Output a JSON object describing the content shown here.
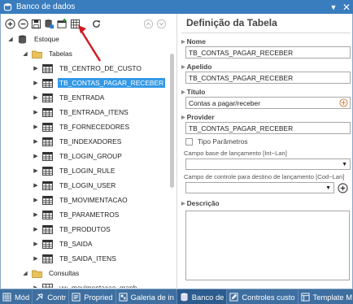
{
  "window": {
    "title": "Banco de dados",
    "pin_glyph": "▼",
    "close_glyph": "✕"
  },
  "toolbar": {
    "buttons": [
      "add-icon",
      "remove-icon",
      "save-icon",
      "database-save-icon",
      "table-new-icon",
      "grid-icon",
      "refresh-icon"
    ],
    "nav": [
      "up-icon",
      "down-icon"
    ]
  },
  "tree": {
    "root": {
      "label": "Estoque",
      "expander": "◢"
    },
    "tables_folder": {
      "label": "Tabelas",
      "expander": "◢"
    },
    "tables": [
      "TB_CENTRO_DE_CUSTO",
      "TB_CONTAS_PAGAR_RECEBER",
      "TB_ENTRADA",
      "TB_ENTRADA_ITENS",
      "TB_FORNECEDORES",
      "TB_INDEXADORES",
      "TB_LOGIN_GROUP",
      "TB_LOGIN_RULE",
      "TB_LOGIN_USER",
      "TB_MOVIMENTACAO",
      "TB_PARAMETROS",
      "TB_PRODUTOS",
      "TB_SAIDA",
      "TB_SAIDA_ITENS"
    ],
    "selected_table": "TB_CONTAS_PAGAR_RECEBER",
    "queries_folder": {
      "label": "Consultas",
      "expander": "◢"
    },
    "queries": [
      "vw_movimentacao_graph"
    ],
    "collapsed_glyph": "▶"
  },
  "definition": {
    "title": "Definição da Tabela",
    "nome_label": "Nome",
    "nome_value": "TB_CONTAS_PAGAR_RECEBER",
    "apelido_label": "Apelido",
    "apelido_value": "TB_CONTAS_PAGAR_RECEBER",
    "titulo_label": "Título",
    "titulo_value": "Contas a pagar/receber",
    "provider_label": "Provider",
    "provider_value": "TB_CONTAS_PAGAR_RECEBER",
    "tipo_parametros_label": "Tipo Parâmetros",
    "campo_base_label": "Campo base de lançamento [Int~Lan]",
    "campo_controle_label": "Campo de controle para destino de lançamento [Cod~Lan]",
    "descricao_label": "Descrição",
    "dropdown_glyph": "▼"
  },
  "taskbar": [
    {
      "label": "Mód",
      "icon": "grid-icon"
    },
    {
      "label": "Contr",
      "icon": "pin-icon"
    },
    {
      "label": "Propried",
      "icon": "properties-icon"
    },
    {
      "label": "Galeria de in",
      "icon": "gallery-icon"
    },
    {
      "label": "Banco de",
      "icon": "database-icon",
      "active": true
    },
    {
      "label": "Controles custo",
      "icon": "edit-icon"
    },
    {
      "label": "Template M",
      "icon": "template-icon"
    }
  ],
  "colors": {
    "titlebar": "#3a7dbf",
    "selection": "#3399e6",
    "taskbar": "#3f6fa0",
    "accent_arrow": "#d0191f"
  }
}
